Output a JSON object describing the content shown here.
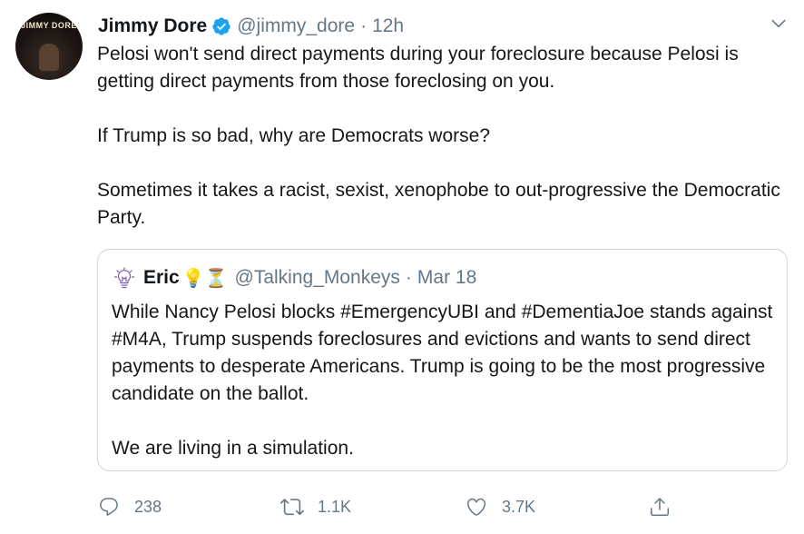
{
  "tweet": {
    "author_name": "Jimmy Dore",
    "handle": "@jimmy_dore",
    "separator": "·",
    "time": "12h",
    "avatar_text": "JIMMY DORE",
    "paragraphs": [
      "Pelosi won't send direct payments during your foreclosure because Pelosi is getting direct payments from those foreclosing on you.",
      "If Trump is so bad, why are Democrats worse?",
      "Sometimes it takes a racist, sexist, xenophobe to out-progressive the Democratic Party."
    ]
  },
  "quote": {
    "author_name": "Eric",
    "emojis": "💡⏳",
    "handle": "@Talking_Monkeys",
    "separator": "·",
    "time": "Mar 18",
    "paragraphs": [
      "While Nancy Pelosi blocks #EmergencyUBI and #DementiaJoe stands against #M4A, Trump suspends foreclosures and evictions and wants to send direct payments to desperate Americans. Trump is going to be the most progressive candidate on the ballot.",
      "We are living in a simulation."
    ]
  },
  "actions": {
    "reply_count": "238",
    "retweet_count": "1.1K",
    "like_count": "3.7K"
  },
  "colors": {
    "verified_blue": "#1da1f2",
    "secondary_text": "#657786",
    "border": "#ccd6dd"
  },
  "icons": {
    "verified": "verified-badge-icon",
    "menu": "chevron-down-icon",
    "reply": "reply-icon",
    "retweet": "retweet-icon",
    "like": "heart-icon",
    "share": "share-icon",
    "quote_avatar": "lightbulb-icon"
  }
}
